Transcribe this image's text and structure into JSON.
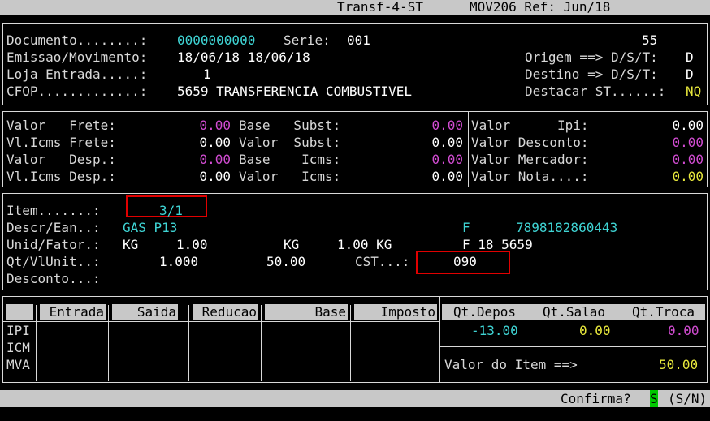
{
  "title_bar": {
    "program": "Transf-4-ST",
    "movement": "MOV206 Ref: Jun/18"
  },
  "header": {
    "documento_label": "Documento........:",
    "documento_value": "0000000000",
    "serie_label": "Serie:",
    "serie_value": "001",
    "top_right_value": "55",
    "emissao_label": "Emissao/Movimento:",
    "emissao_value": "18/06/18 18/06/18",
    "origem_label": "Origem ==> D/S/T:",
    "origem_value": "D",
    "loja_label": "Loja Entrada.....:",
    "loja_value": "1",
    "destino_label": "Destino => D/S/T:",
    "destino_value": "D",
    "cfop_label": "CFOP.............:",
    "cfop_value": "5659 TRANSFERENCIA COMBUSTIVEL",
    "destacar_label": "Destacar ST......:",
    "destacar_value": "NQ"
  },
  "totals": {
    "col1": [
      {
        "label": "Valor   Frete:",
        "value": "0.00",
        "color": "#d24cd2"
      },
      {
        "label": "Vl.Icms Frete:",
        "value": "0.00",
        "color": "#ffffff"
      },
      {
        "label": "Valor   Desp.:",
        "value": "0.00",
        "color": "#d24cd2"
      },
      {
        "label": "Vl.Icms Desp.:",
        "value": "0.00",
        "color": "#ffffff"
      }
    ],
    "col2": [
      {
        "label": "Base   Subst:",
        "value": "0.00",
        "color": "#d24cd2"
      },
      {
        "label": "Valor  Subst:",
        "value": "0.00",
        "color": "#ffffff"
      },
      {
        "label": "Base    Icms:",
        "value": "0.00",
        "color": "#d24cd2"
      },
      {
        "label": "Valor   Icms:",
        "value": "0.00",
        "color": "#ffffff"
      }
    ],
    "col3": [
      {
        "label": "Valor      Ipi:",
        "value": "0.00",
        "color": "#ffffff"
      },
      {
        "label": "Valor Desconto:",
        "value": "0.00",
        "color": "#d24cd2"
      },
      {
        "label": "Valor Mercador:",
        "value": "0.00",
        "color": "#d24cd2"
      },
      {
        "label": "Valor Nota....:",
        "value": "0.00",
        "color": "#e8e83c"
      }
    ]
  },
  "item": {
    "item_label": "Item.......:",
    "item_value": "3/1",
    "descr_label": "Descr/Ean..:",
    "descr_value": "GAS P13",
    "descr_flag": "F",
    "ean": "7898182860443",
    "unid_label": "Unid/Fator.:",
    "unid1": "KG",
    "fator1": "1.00",
    "unid2": "KG",
    "fator2": "1.00 KG",
    "unid_flag": "F 18 5659",
    "qt_label": "Qt/VlUnit..:",
    "qt_value": "1.000",
    "vlunit_value": "50.00",
    "cst_label": "CST...:",
    "cst_value": "090",
    "desconto_label": "Desconto...:"
  },
  "tax_table": {
    "headers": [
      "Entrada",
      "Saida",
      "Reducao",
      "Base",
      "Imposto"
    ],
    "rows": [
      "IPI",
      "ICM",
      "MVA"
    ]
  },
  "stock": {
    "headers": [
      "Qt.Depos",
      "Qt.Salao",
      "Qt.Troca"
    ],
    "values": [
      "-13.00",
      "0.00",
      "0.00"
    ],
    "valor_item_label": "Valor do Item ==>",
    "valor_item_value": "50.00"
  },
  "footer": {
    "prompt": "Confirma?",
    "answer": "S",
    "options": "(S/N)"
  },
  "colors": {
    "cyan": "#3fd4d4",
    "magenta": "#d24cd2",
    "yellow": "#e8e83c",
    "highlight": "#e00000",
    "answer_bg": "#00c800"
  }
}
